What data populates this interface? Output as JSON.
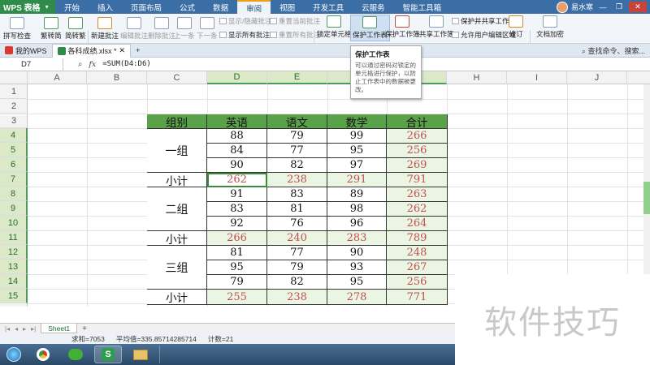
{
  "app": {
    "name": "WPS 表格",
    "menu_tabs": [
      "开始",
      "插入",
      "页面布局",
      "公式",
      "数据",
      "审阅",
      "视图",
      "开发工具",
      "云服务",
      "智能工具箱"
    ],
    "active_tab": "审阅",
    "user_name": "易水寒"
  },
  "ribbon": {
    "spell_check": "拼写检查",
    "trad_to_simp": "繁转简",
    "simp_to_trad": "简转繁",
    "new_comment": "新建批注",
    "edit_comment": "编辑批注",
    "delete_comment": "删除批注",
    "prev": "上一条",
    "next": "下一条",
    "show_hide_comment": "显示/隐藏批注",
    "show_all_comments": "显示所有批注",
    "reset_current_comment": "重置当前批注",
    "reset_all_comments": "重置所有批注",
    "lock_cell": "锁定单元格",
    "protect_sheet": "保护工作表",
    "protect_workbook": "保护工作簿",
    "share_workbook": "共享工作簿",
    "protect_and_share": "保护并共享工作簿",
    "allow_edit_ranges": "允许用户编辑区域",
    "track_changes": "修订",
    "doc_encrypt": "文档加密"
  },
  "doc_tabs": {
    "home_tab": "我的WPS",
    "file_tab": "各科成绩.xlsx *",
    "search_hint": "查找命令、搜索..."
  },
  "formula_bar": {
    "name_box": "D7",
    "fx": "fx",
    "formula": "=SUM(D4:D6)"
  },
  "tooltip": {
    "title": "保护工作表",
    "body": "可以通过密码对锁定的单元格进行保护，以防止工作表中的数据被更改。"
  },
  "grid": {
    "columns": [
      "A",
      "B",
      "C",
      "D",
      "E",
      "F",
      "G",
      "H",
      "I",
      "J"
    ],
    "rows": [
      "1",
      "2",
      "3",
      "4",
      "5",
      "6",
      "7",
      "8",
      "9",
      "10",
      "11",
      "12",
      "13",
      "14",
      "15"
    ]
  },
  "table": {
    "headers": [
      "组别",
      "英语",
      "语文",
      "数学",
      "合计"
    ],
    "groups": [
      {
        "name": "一组",
        "rows": [
          [
            "88",
            "79",
            "99",
            "266"
          ],
          [
            "84",
            "77",
            "95",
            "256"
          ],
          [
            "90",
            "82",
            "97",
            "269"
          ]
        ],
        "subtotal_label": "小计",
        "subtotal": [
          "262",
          "238",
          "291",
          "791"
        ]
      },
      {
        "name": "二组",
        "rows": [
          [
            "91",
            "83",
            "89",
            "263"
          ],
          [
            "83",
            "81",
            "98",
            "262"
          ],
          [
            "92",
            "76",
            "96",
            "264"
          ]
        ],
        "subtotal_label": "小计",
        "subtotal": [
          "266",
          "240",
          "283",
          "789"
        ]
      },
      {
        "name": "三组",
        "rows": [
          [
            "81",
            "77",
            "90",
            "248"
          ],
          [
            "95",
            "79",
            "93",
            "267"
          ],
          [
            "79",
            "82",
            "95",
            "256"
          ]
        ],
        "subtotal_label": "小计",
        "subtotal": [
          "255",
          "238",
          "278",
          "771"
        ]
      }
    ]
  },
  "sheet_tab": "Sheet1",
  "status": {
    "sum": "求和=7053",
    "average": "平均值=335.85714285714",
    "count": "计数=21"
  },
  "watermark": "软件技巧",
  "colors": {
    "header_green": "#5aa24a",
    "total_red": "#c0504d",
    "total_bg": "#eaf5e4",
    "menubar_blue": "#3b6ea5"
  }
}
